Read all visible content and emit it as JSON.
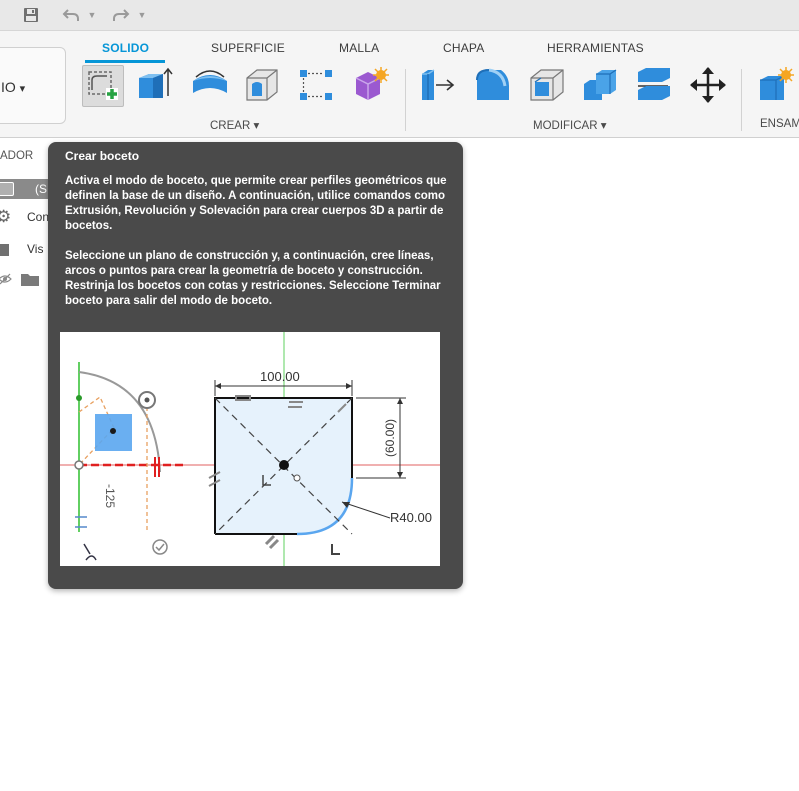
{
  "toolbar": {
    "save_icon": "save-icon",
    "undo_icon": "undo-icon",
    "redo_icon": "redo-icon",
    "dropdown_icon": "chevron-down-icon"
  },
  "workspace": {
    "label": "IO",
    "dropdown": "▾"
  },
  "tabs": [
    {
      "label": "SOLIDO",
      "active": true
    },
    {
      "label": "SUPERFICIE",
      "active": false
    },
    {
      "label": "MALLA",
      "active": false
    },
    {
      "label": "CHAPA",
      "active": false
    },
    {
      "label": "HERRAMIENTAS",
      "active": false
    }
  ],
  "groups": {
    "crear": "CREAR ▾",
    "modificar": "MODIFICAR ▾",
    "ensamblar": "ENSAM"
  },
  "browser": {
    "header": "ADOR",
    "row1": "(S",
    "row2": "Con",
    "row3": "Vis"
  },
  "tooltip": {
    "title": "Crear boceto",
    "paragraph1": "Activa el modo de boceto, que permite crear perfiles geométricos que definen la base de un diseño. A continuación, utilice comandos como Extrusión, Revolución y Solevación para crear cuerpos 3D a partir de bocetos.",
    "paragraph2": "Seleccione un plano de construcción y, a continuación, cree líneas, arcos o puntos para crear la geometría de boceto y construcción. Restrinja los bocetos con cotas y restricciones. Seleccione Terminar boceto para salir del modo de boceto.",
    "image": {
      "dim_width": "100.00",
      "dim_height": "(60.00)",
      "dim_radius": "R40.00",
      "dim_left": "-125"
    }
  },
  "colors": {
    "accent": "#0696d7",
    "tooltip_bg": "#4a4a4a",
    "ribbon_bg": "#f5f5f5",
    "icon_blue": "#2f8ddc"
  }
}
